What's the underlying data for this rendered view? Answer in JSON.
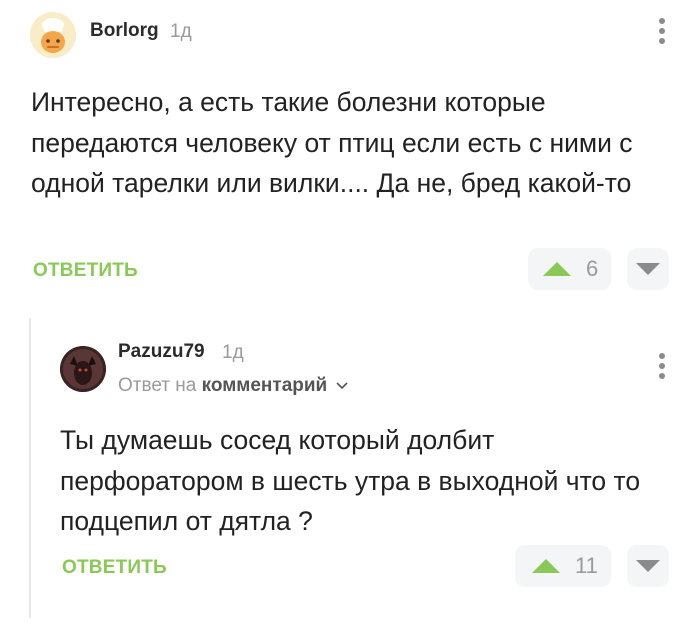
{
  "comment": {
    "author": "Borlorg",
    "time": "1д",
    "text": "Интересно, а есть такие болезни которые передаются человеку от птиц если есть с ними с одной тарелки или вилки.... Да не, бред какой-то",
    "reply_label": "ОТВЕТИТЬ",
    "rating": "6"
  },
  "reply": {
    "author": "Pazuzu79",
    "time": "1д",
    "meta_prefix": "Ответ на",
    "meta_target": "комментарий",
    "text": "Ты думаешь сосед который долбит перфоратором в шесть утра в выходной что то подцепил от дятла ?",
    "reply_label": "ОТВЕТИТЬ",
    "rating": "11"
  },
  "colors": {
    "accent": "#8ac858",
    "muted": "#9a9a9a",
    "vote_bg": "#f4f5f7"
  },
  "icons": [
    "chef-avatar",
    "kebab-menu-icon",
    "upvote-icon",
    "downvote-icon",
    "chevron-down-icon"
  ]
}
